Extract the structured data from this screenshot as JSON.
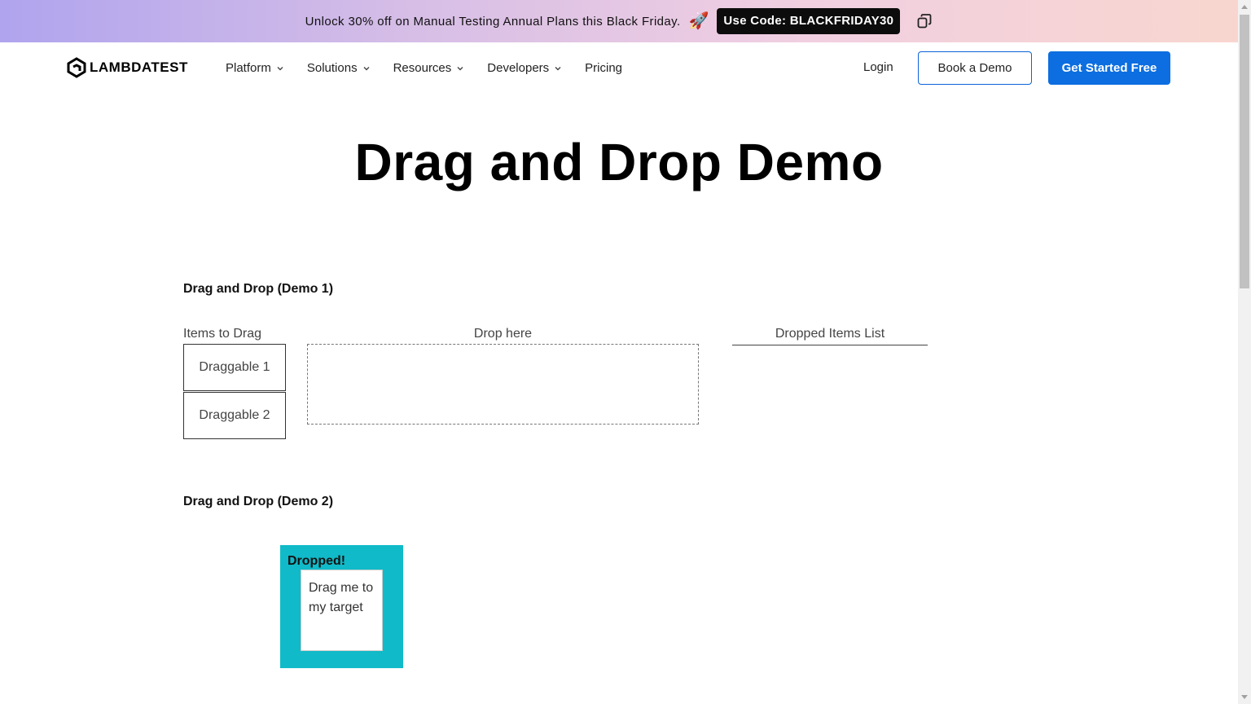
{
  "promo": {
    "text": "Unlock 30% off on Manual Testing Annual Plans this Black Friday.",
    "emoji": "🚀",
    "code": "Use Code: BLACKFRIDAY30"
  },
  "nav": {
    "logo": "LAMBDATEST",
    "items": [
      "Platform",
      "Solutions",
      "Resources",
      "Developers",
      "Pricing"
    ],
    "login": "Login",
    "book_demo": "Book a Demo",
    "get_started": "Get Started Free"
  },
  "main": {
    "title": "Drag and Drop Demo",
    "demo1": {
      "title": "Drag and Drop (Demo 1)",
      "items_label": "Items to Drag",
      "drop_label": "Drop here",
      "dropped_label": "Dropped Items List",
      "draggables": [
        "Draggable 1",
        "Draggable 2"
      ]
    },
    "demo2": {
      "title": "Drag and Drop (Demo 2)",
      "target_label": "Dropped!",
      "drag_text": "Drag me to my target"
    }
  },
  "colors": {
    "accent": "#0c6ee0",
    "target": "#10bac8"
  }
}
